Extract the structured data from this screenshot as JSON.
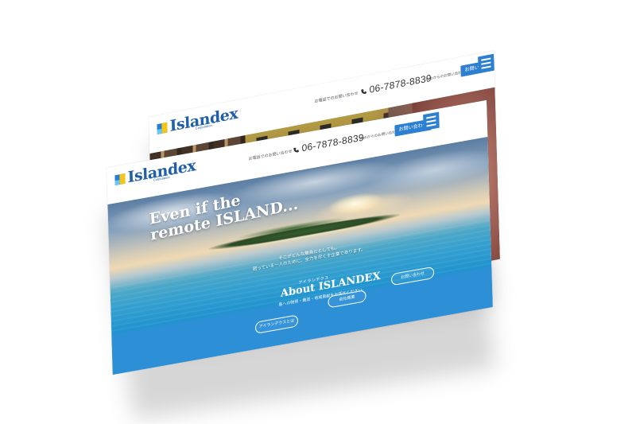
{
  "brand": {
    "logo_text": "Islandex",
    "logo_sub": "Corporation"
  },
  "header": {
    "tel_label": "お電話でのお問い合わせ",
    "tel": "06-7878-8839",
    "mail_label": "Webからのお問い合わせ",
    "contact_button": "お問い合わせ"
  },
  "hero": {
    "catch": "Even if the\nremote ISLAND...",
    "tagline": "そこがどんな離島だとしても。\n困っている一人のために、全力を尽くす企業であります。"
  },
  "about": {
    "ruby": "アイランデクス",
    "title": "About ISLANDEX",
    "subtitle": "島への物資・搬送・地域貢献をお任せください。"
  },
  "buttons": [
    {
      "label": "アイランデクスとは"
    },
    {
      "label": "会社概要"
    },
    {
      "label": "お問い合わせ"
    }
  ],
  "colors": {
    "brand_blue": "#2d7fd0",
    "logo_yellow": "#f5c518",
    "panel_blue": "#2d8fd6"
  },
  "icons": {
    "phone": "phone-icon",
    "menu": "hamburger-menu-icon",
    "logo": "islandex-logo-mark"
  }
}
